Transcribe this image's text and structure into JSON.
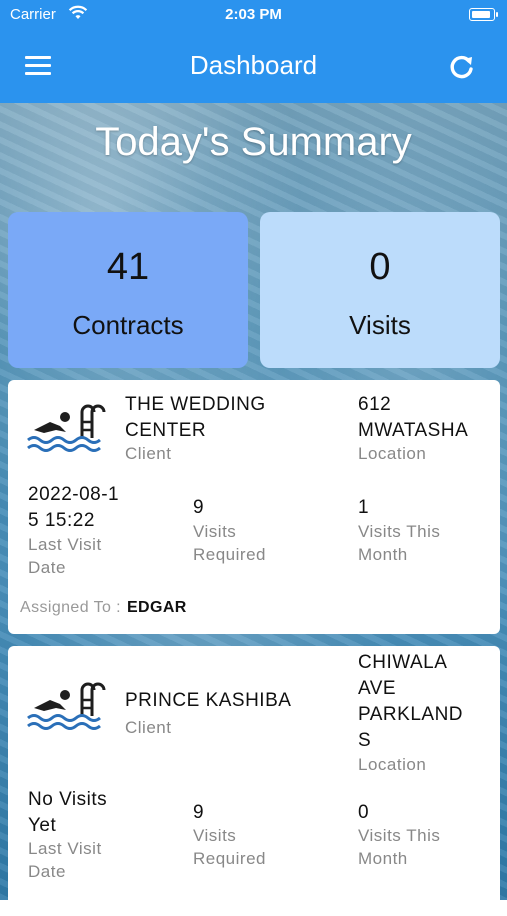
{
  "status_bar": {
    "carrier": "Carrier",
    "time": "2:03 PM"
  },
  "header": {
    "title": "Dashboard",
    "menu_icon": "hamburger-icon",
    "refresh_icon": "refresh-icon"
  },
  "summary": {
    "title": "Today's Summary",
    "tiles": [
      {
        "value": "41",
        "label": "Contracts",
        "color": "#7aa9f7"
      },
      {
        "value": "0",
        "label": "Visits",
        "color": "#bcdcfb"
      }
    ]
  },
  "colors": {
    "header": "#2b93ee",
    "card": "#ffffff",
    "muted": "#888888"
  },
  "contracts": [
    {
      "client_name_1": "THE WEDDING",
      "client_name_2": "CENTER",
      "client_label": "Client",
      "location_1": "612",
      "location_2": "MWATASHA",
      "location_label": "Location",
      "last_visit_1": "2022-08-1",
      "last_visit_2": "5 15:22",
      "last_visit_label_1": "Last Visit",
      "last_visit_label_2": "Date",
      "visits_required": "9",
      "visits_required_label_1": "Visits",
      "visits_required_label_2": "Required",
      "visits_month": "1",
      "visits_month_label_1": "Visits This",
      "visits_month_label_2": "Month",
      "assigned_label": "Assigned To :",
      "assigned_to": "EDGAR"
    },
    {
      "client_name_1": "PRINCE KASHIBA",
      "client_label": "Client",
      "location_1": "CHIWALA",
      "location_2": "AVE",
      "location_3": "PARKLAND",
      "location_4": "S",
      "location_label": "Location",
      "last_visit_1": "No Visits",
      "last_visit_2": "Yet",
      "last_visit_label_1": "Last Visit",
      "last_visit_label_2": "Date",
      "visits_required": "9",
      "visits_required_label_1": "Visits",
      "visits_required_label_2": "Required",
      "visits_month": "0",
      "visits_month_label_1": "Visits This",
      "visits_month_label_2": "Month"
    }
  ]
}
